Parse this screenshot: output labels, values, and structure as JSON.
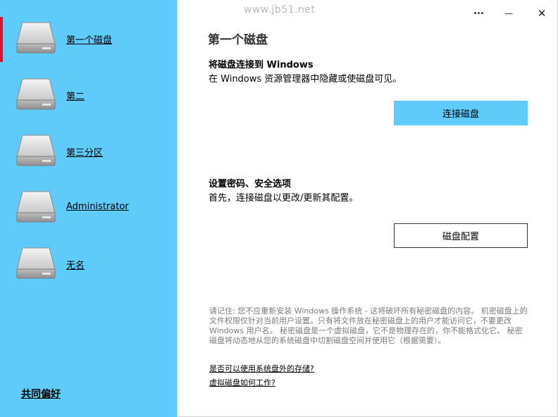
{
  "sidebar": {
    "items": [
      {
        "label": "第一个磁盘",
        "active": true
      },
      {
        "label": "第二",
        "active": false
      },
      {
        "label": "第三分区",
        "active": false
      },
      {
        "label": "Administrator",
        "active": false
      },
      {
        "label": "无名",
        "active": false
      }
    ],
    "footer_label": "共同偏好",
    "icon": "hard-disk-icon"
  },
  "watermark": "www.jb51.net",
  "window_controls": {
    "more": "•••",
    "minimize": "—",
    "close": "✕"
  },
  "main": {
    "title": "第一个磁盘",
    "connect_section": {
      "heading": "将磁盘连接到 Windows",
      "description": "在 Windows 资源管理器中隐藏或使磁盘可见。",
      "button_label": "连接磁盘"
    },
    "security_section": {
      "heading": "设置密码、安全选项",
      "description": "首先，连接磁盘以更改/更新其配置。",
      "button_label": "磁盘配置"
    },
    "notice": "请记住: 您不应重新安装 Windows 操作系统 - 这将破坏所有秘密磁盘的内容。 机密磁盘上的文件权限仅针对当前用户设置。只有将文件放在秘密磁盘上的用户才能访问它，不要更改 Windows 用户名。 秘密磁盘是一个虚拟磁盘，它不是物理存在的，你不能格式化它。 秘密磁盘将动态地从您的系统磁盘中切割磁盘空间并使用它（根据需要）。",
    "links": [
      "是否可以使用系统盘外的存储?",
      "虚拟磁盘如何工作?"
    ]
  },
  "colors": {
    "accent": "#5fcbfa",
    "active_marker": "#e81123",
    "notice_text": "#7a7a7a"
  }
}
